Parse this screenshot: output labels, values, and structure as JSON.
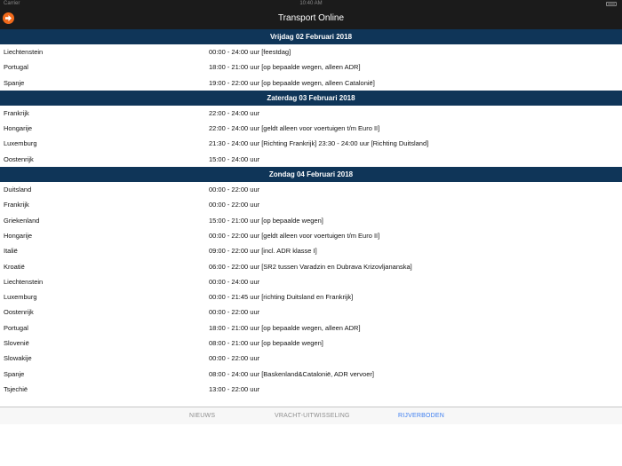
{
  "status_bar": {
    "carrier": "Carrier",
    "time": "10:40 AM"
  },
  "header": {
    "title": "Transport Online",
    "back_icon": "arrow-right-circle-icon",
    "accent": "#f26a1b"
  },
  "sections": [
    {
      "title": "Vrijdag 02 Februari 2018",
      "rows": [
        {
          "country": "Liechtenstein",
          "hours": "00:00 - 24:00 uur [feestdag]"
        },
        {
          "country": "Portugal",
          "hours": "18:00 - 21:00 uur [op bepaalde wegen, alleen ADR]"
        },
        {
          "country": "Spanje",
          "hours": "19:00 - 22:00 uur [op bepaalde wegen, alleen Catalonië]"
        }
      ]
    },
    {
      "title": "Zaterdag 03 Februari 2018",
      "rows": [
        {
          "country": "Frankrijk",
          "hours": "22:00 - 24:00 uur"
        },
        {
          "country": "Hongarije",
          "hours": "22:00 - 24:00 uur [geldt alleen voor voertuigen t/m Euro II]"
        },
        {
          "country": "Luxemburg",
          "hours": "21:30 - 24:00 uur [Richting Frankrijk]  23:30 - 24:00 uur [Richting Duitsland]"
        },
        {
          "country": "Oostenrijk",
          "hours": "15:00 - 24:00 uur"
        }
      ]
    },
    {
      "title": "Zondag 04 Februari 2018",
      "rows": [
        {
          "country": "Duitsland",
          "hours": "00:00 - 22:00 uur"
        },
        {
          "country": "Frankrijk",
          "hours": "00:00 - 22:00 uur"
        },
        {
          "country": "Griekenland",
          "hours": "15:00 - 21:00 uur [op bepaalde wegen]"
        },
        {
          "country": "Hongarije",
          "hours": "00:00 - 22:00 uur [geldt alleen voor voertuigen t/m Euro II]"
        },
        {
          "country": "Italië",
          "hours": "09:00 - 22:00 uur [incl. ADR klasse I]"
        },
        {
          "country": "Kroatië",
          "hours": "06:00 - 22:00 uur [SR2 tussen Varadzin en Dubrava Krizovljananska]"
        },
        {
          "country": "Liechtenstein",
          "hours": "00:00 - 24:00 uur"
        },
        {
          "country": "Luxemburg",
          "hours": "00:00 - 21:45 uur [richting Duitsland en Frankrijk]"
        },
        {
          "country": "Oostenrijk",
          "hours": "00:00 - 22:00 uur"
        },
        {
          "country": "Portugal",
          "hours": "18:00 - 21:00 uur [op bepaalde wegen, alleen ADR]"
        },
        {
          "country": "Slovenië",
          "hours": "08:00 - 21:00 uur [op bepaalde wegen]"
        },
        {
          "country": "Slowakije",
          "hours": "00:00 - 22:00 uur"
        },
        {
          "country": "Spanje",
          "hours": "08:00 - 24:00 uur [Baskenland&Catalonië, ADR vervoer]"
        },
        {
          "country": "Tsjechië",
          "hours": "13:00 - 22:00 uur"
        }
      ]
    }
  ],
  "tabs": [
    {
      "label": "NIEUWS",
      "active": false
    },
    {
      "label": "VRACHT-UITWISSELING",
      "active": false
    },
    {
      "label": "RIJVERBODEN",
      "active": true
    }
  ],
  "colors": {
    "section_header": "#0f3558",
    "nav_bar": "#1b1b1b",
    "tab_active": "#3f7ff0",
    "tab_inactive": "#8e8e8e"
  }
}
